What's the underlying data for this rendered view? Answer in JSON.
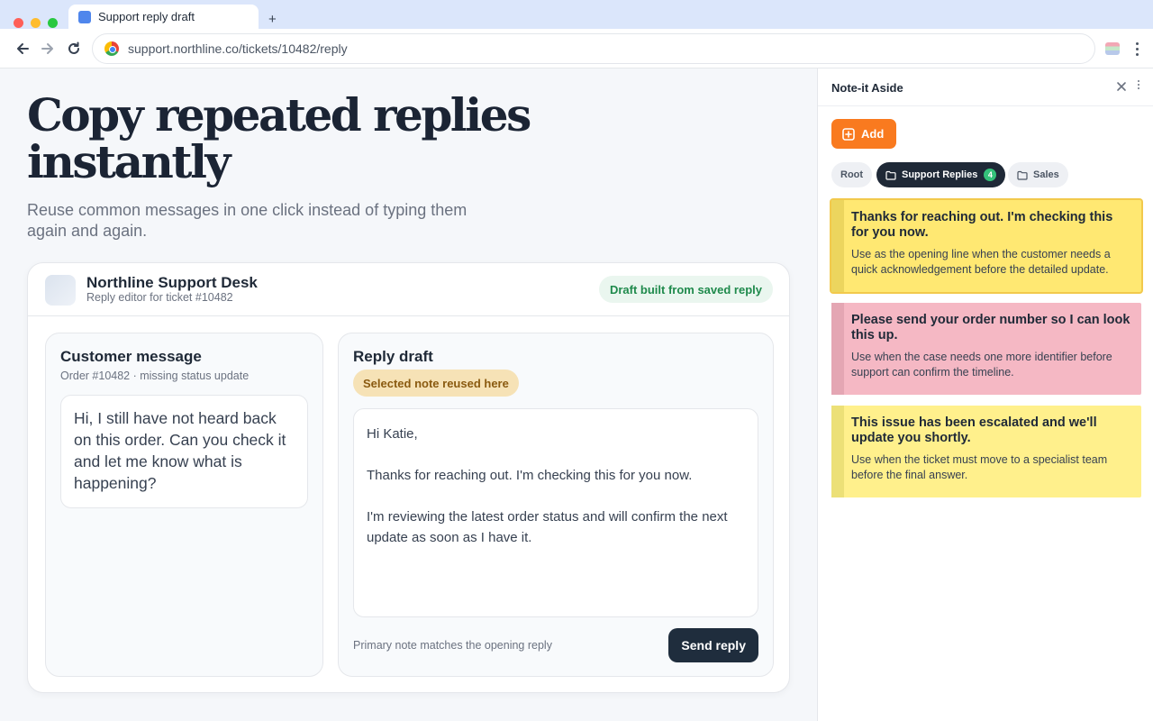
{
  "browser": {
    "tab_title": "Support reply draft",
    "new_tab": "+",
    "url": "support.northline.co/tickets/10482/reply"
  },
  "hero": {
    "title": "Copy repeated replies instantly",
    "subtitle": "Reuse common messages in one click instead of typing them again and again."
  },
  "desk": {
    "title": "Northline Support Desk",
    "subtitle": "Reply editor for ticket #10482",
    "badge": "Draft built from saved reply"
  },
  "customer": {
    "title": "Customer message",
    "subtitle": "Order #10482 · missing status update",
    "message": "Hi, I still have not heard back on this order. Can you check it and let me know what is happening?"
  },
  "reply": {
    "title": "Reply draft",
    "badge": "Selected note reused here",
    "greeting": "Hi Katie,",
    "line1": "Thanks for reaching out. I'm checking this for you now.",
    "line2": "I'm reviewing the latest order status and will confirm the next update as soon as I have it.",
    "footer_note": "Primary note matches the opening reply",
    "send_label": "Send reply"
  },
  "side_panel": {
    "title": "Note-it Aside",
    "add_label": "Add",
    "folders": [
      {
        "label": "Root"
      },
      {
        "label": "Support Replies",
        "count": "4"
      },
      {
        "label": "Sales"
      }
    ],
    "notes": [
      {
        "title": "Thanks for reaching out. I'm checking this for you now.",
        "desc": "Use as the opening line when the customer needs a quick acknowledgement before the detailed update.",
        "color": "#ffe872"
      },
      {
        "title": "Please send your order number so I can look this up.",
        "desc": "Use when the case needs one more identifier before support can confirm the timeline.",
        "color": "#f5b8c4"
      },
      {
        "title": "This issue has been escalated and we'll update you shortly.",
        "desc": "Use when the ticket must move to a specialist team before the final answer.",
        "color": "#fff08c"
      }
    ]
  },
  "colors": {
    "accent_orange": "#f97a1f",
    "dark_button": "#1f2d3d",
    "success_green": "#1f8a4c"
  }
}
